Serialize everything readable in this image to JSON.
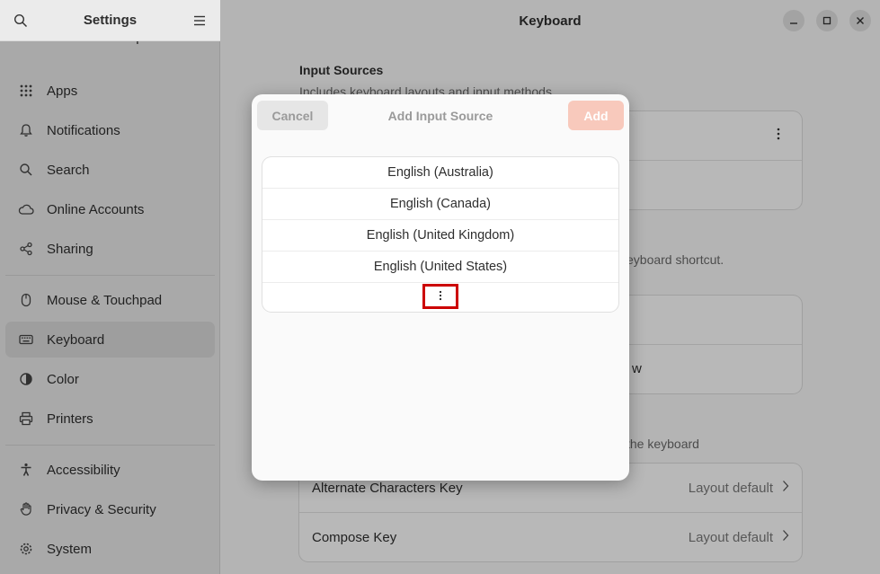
{
  "sidebar": {
    "title": "Settings",
    "partial_item": "Ubuntu Desktop",
    "items": [
      {
        "label": "Apps",
        "icon": "apps-grid-icon"
      },
      {
        "label": "Notifications",
        "icon": "bell-icon"
      },
      {
        "label": "Search",
        "icon": "search-icon"
      },
      {
        "label": "Online Accounts",
        "icon": "cloud-icon"
      },
      {
        "label": "Sharing",
        "icon": "share-icon"
      },
      {
        "label": "Mouse & Touchpad",
        "icon": "mouse-icon"
      },
      {
        "label": "Keyboard",
        "icon": "keyboard-icon",
        "active": true
      },
      {
        "label": "Color",
        "icon": "color-icon"
      },
      {
        "label": "Printers",
        "icon": "printer-icon"
      },
      {
        "label": "Accessibility",
        "icon": "accessibility-icon"
      },
      {
        "label": "Privacy & Security",
        "icon": "hand-icon"
      },
      {
        "label": "System",
        "icon": "gear-icon"
      }
    ]
  },
  "main": {
    "title": "Keyboard",
    "input_sources": {
      "title": "Input Sources",
      "subtitle": "Includes keyboard layouts and input methods"
    },
    "partial_text_1": "eyboard shortcut.",
    "partial_text_2": "w",
    "partial_text_3": "the keyboard",
    "rows": [
      {
        "label": "Alternate Characters Key",
        "value": "Layout default"
      },
      {
        "label": "Compose Key",
        "value": "Layout default"
      }
    ]
  },
  "dialog": {
    "title": "Add Input Source",
    "cancel_label": "Cancel",
    "add_label": "Add",
    "languages": [
      "English (Australia)",
      "English (Canada)",
      "English (United Kingdom)",
      "English (United States)"
    ],
    "more_icon": "vertical-dots-icon"
  },
  "colors": {
    "accent_disabled": "#f8c9bc",
    "highlight": "#cc0000"
  }
}
